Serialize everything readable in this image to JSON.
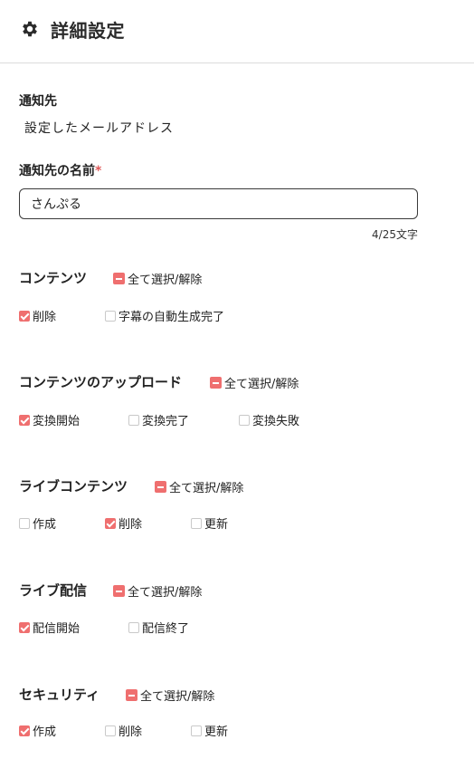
{
  "header": {
    "title": "詳細設定",
    "icon": "gear-icon"
  },
  "destination": {
    "label": "通知先",
    "value": "設定したメールアドレス"
  },
  "name": {
    "label": "通知先の名前",
    "required_mark": "*",
    "value": "さんぷる",
    "counter": "4/25文字"
  },
  "colors": {
    "accent": "#ef6f6f",
    "border": "#3a3a3a"
  },
  "sections": [
    {
      "title": "コンテンツ",
      "select_all": "全て選択/解除",
      "options": [
        {
          "label": "削除",
          "checked": true
        },
        {
          "label": "字幕の自動生成完了",
          "checked": false
        }
      ]
    },
    {
      "title": "コンテンツのアップロード",
      "select_all": "全て選択/解除",
      "options": [
        {
          "label": "変換開始",
          "checked": true
        },
        {
          "label": "変換完了",
          "checked": false
        },
        {
          "label": "変換失敗",
          "checked": false
        }
      ]
    },
    {
      "title": "ライブコンテンツ",
      "select_all": "全て選択/解除",
      "options": [
        {
          "label": "作成",
          "checked": false
        },
        {
          "label": "削除",
          "checked": true
        },
        {
          "label": "更新",
          "checked": false
        }
      ]
    },
    {
      "title": "ライブ配信",
      "select_all": "全て選択/解除",
      "options": [
        {
          "label": "配信開始",
          "checked": true
        },
        {
          "label": "配信終了",
          "checked": false
        }
      ]
    },
    {
      "title": "セキュリティ",
      "select_all": "全て選択/解除",
      "options": [
        {
          "label": "作成",
          "checked": true
        },
        {
          "label": "削除",
          "checked": false
        },
        {
          "label": "更新",
          "checked": false
        }
      ]
    }
  ]
}
